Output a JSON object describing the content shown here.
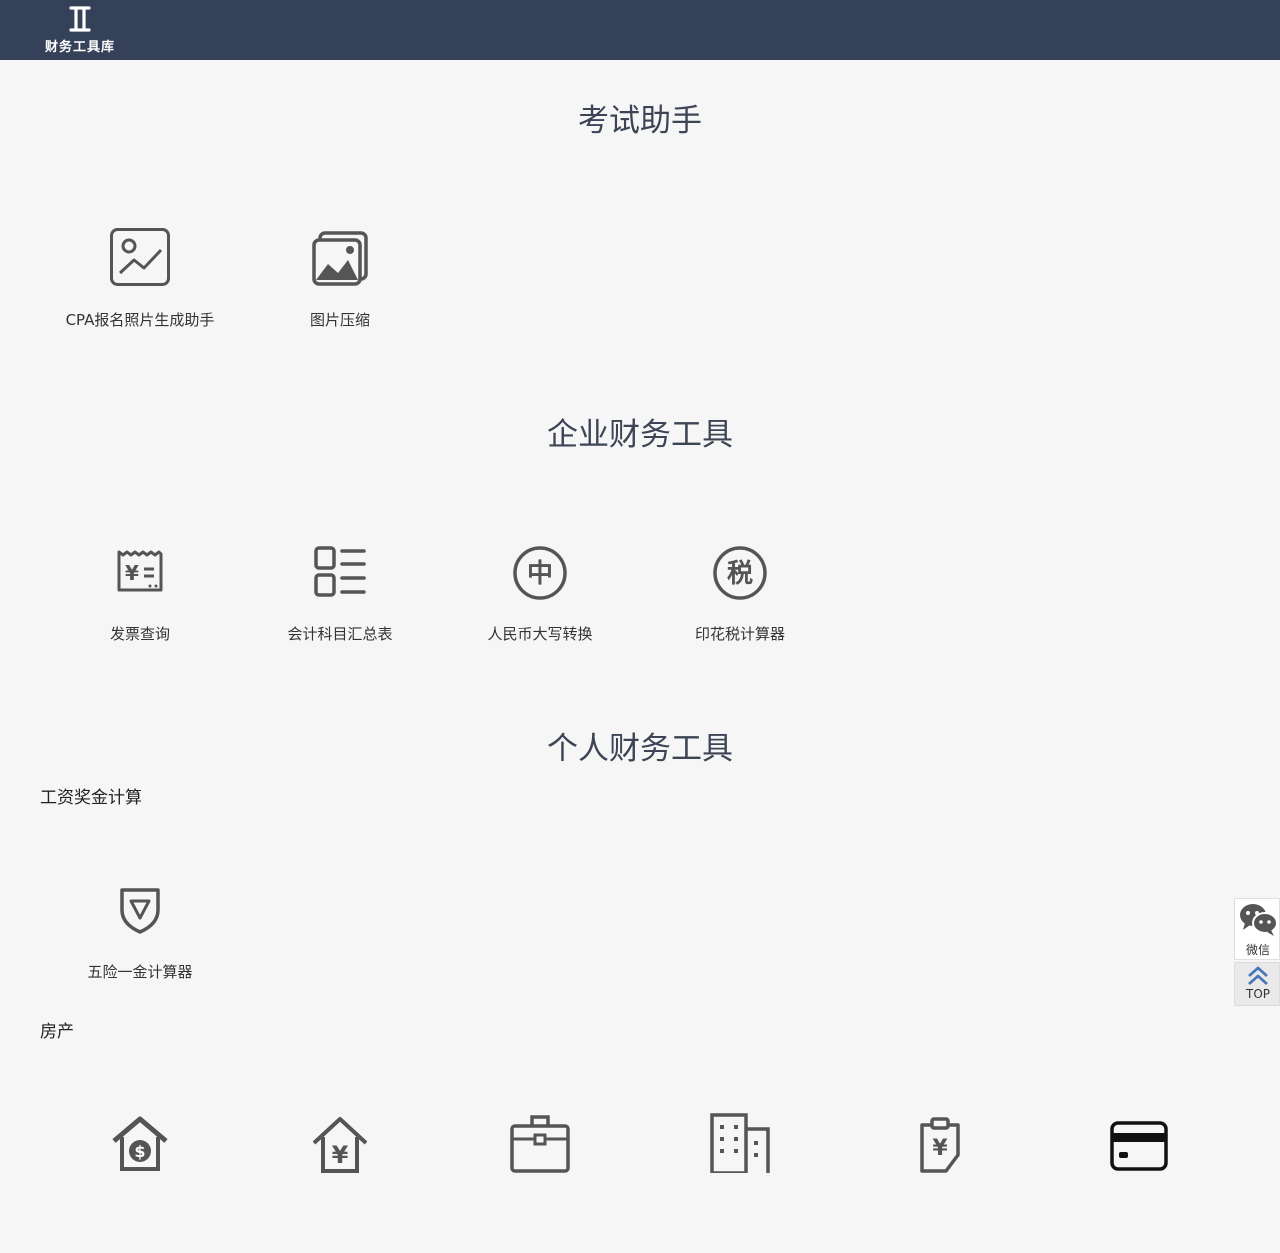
{
  "header": {
    "logo_text": "财务工具库",
    "logo_icon": "logo-mark-icon"
  },
  "sections": {
    "exam": {
      "title": "考试助手",
      "tools": [
        {
          "label": "CPA报名照片生成助手",
          "icon": "photo-frame-icon"
        },
        {
          "label": "图片压缩",
          "icon": "image-compress-icon"
        }
      ]
    },
    "enterprise": {
      "title": "企业财务工具",
      "tools": [
        {
          "label": "发票查询",
          "icon": "invoice-icon"
        },
        {
          "label": "会计科目汇总表",
          "icon": "list-grid-icon"
        },
        {
          "label": "人民币大写转换",
          "icon": "zhong-circle-icon",
          "glyph": "中"
        },
        {
          "label": "印花税计算器",
          "icon": "tax-circle-icon",
          "glyph": "税"
        }
      ]
    },
    "personal": {
      "title": "个人财务工具",
      "groups": {
        "salary": {
          "title": "工资奖金计算",
          "tools": [
            {
              "label": "五险一金计算器",
              "icon": "shield-icon"
            }
          ]
        },
        "housing": {
          "title": "房产",
          "tools": [
            {
              "icon": "house-dollar-icon",
              "glyph": "$"
            },
            {
              "icon": "house-yuan-icon",
              "glyph": "¥"
            },
            {
              "icon": "briefcase-icon"
            },
            {
              "icon": "building-icon"
            },
            {
              "icon": "clipboard-yuan-icon",
              "glyph": "¥"
            },
            {
              "icon": "bank-card-icon"
            }
          ]
        }
      }
    }
  },
  "side": {
    "wechat_label": "微信",
    "top_label": "TOP"
  },
  "colors": {
    "header_bg": "#354159",
    "page_bg": "#f6f6f6",
    "icon": "#555555",
    "title": "#3d4455",
    "accent": "#4a76b8"
  }
}
